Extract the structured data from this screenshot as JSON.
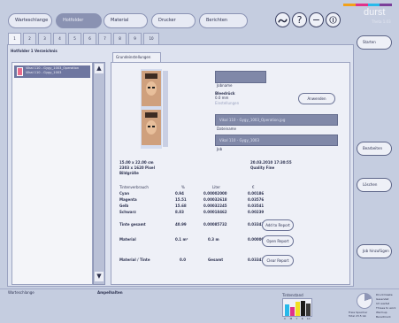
{
  "top_nav": {
    "tabs": [
      {
        "label": "Warteschlange"
      },
      {
        "label": "Hotfolder"
      },
      {
        "label": "Material"
      },
      {
        "label": "Drucker"
      },
      {
        "label": "Berichten"
      }
    ]
  },
  "brand": {
    "name": "durst",
    "sub": "Theta 1.03"
  },
  "hotfolder_tabs": [
    "1",
    "2",
    "3",
    "4",
    "5",
    "6",
    "7",
    "8",
    "9",
    "10"
  ],
  "left_panel": {
    "title": "Hotfolder 1 Verzeichnis",
    "files": [
      "Vikal 110 - Gygy_1003_Operation",
      "Vikal 110 - Gygy_1003"
    ]
  },
  "detail_tab": "Grundeinstellungen",
  "detail": {
    "field1_label": "Jobname",
    "layout_label": "Bleedrück",
    "layout_value": "0.0 mm",
    "layout_sub": "Einstellungen",
    "position_label": "Ausrichten",
    "file1": "Vikal 110 - Gygy_1003_Operation.jpg",
    "file1_label": "Dateiname",
    "file2": "Vikal 110 - Gygy_1003",
    "file2_label": "Job",
    "size": "15.00 x 22.00 cm",
    "resolution": "2303 x 1620 Pixel",
    "mode": "Bildgröße",
    "datetime": "20.03.2010 17:30:55",
    "quality": "Quality Fine"
  },
  "ink_table": {
    "headers": [
      "Tintenverbrauch",
      "%",
      "Liter",
      "€"
    ],
    "rows": [
      {
        "name": "Cyan",
        "pct": "0.94",
        "liter": "0.00002000",
        "eur": "0.00186"
      },
      {
        "name": "Magenta",
        "pct": "15.51",
        "liter": "0.00032618",
        "eur": "0.03576"
      },
      {
        "name": "Gelb",
        "pct": "15.68",
        "liter": "0.00032245",
        "eur": "0.03541"
      },
      {
        "name": "Schwarz",
        "pct": "8.83",
        "liter": "0.00018462",
        "eur": "0.00239"
      }
    ],
    "total": {
      "name": "Tinte gesamt",
      "pct": "40.99",
      "liter": "0.00085732",
      "eur": "0.03343"
    },
    "material": {
      "name": "Material",
      "a": "0.1 m²",
      "b": "0.3 m",
      "eur": "0.00000"
    },
    "material_ink": {
      "name": "Material / Tinte",
      "a": "0.0",
      "b": "Gesamt",
      "eur": "0.03343"
    }
  },
  "buttons": {
    "add_to_report": "Add to Report",
    "open_report": "Open Report",
    "clear_report": "Clear Report",
    "anwenden": "Anwenden",
    "starten": "Starten",
    "bearbeiten": "Bearbeiten",
    "loeschen": "Löschen",
    "job_hinzufuegen": "Job hinzufügen"
  },
  "status_bar": {
    "left": "Warteschlange",
    "center": "Ampelhalten"
  },
  "ink_levels": {
    "title": "Tintenstand",
    "bars": [
      {
        "name": "C",
        "color": "#28b9ea",
        "level": 0.7
      },
      {
        "name": "M",
        "color": "#e0338b",
        "level": 0.55
      },
      {
        "name": "Y",
        "color": "#f1e021",
        "level": 0.85
      },
      {
        "name": "K",
        "color": "#1a1a1a",
        "level": 0.9
      },
      {
        "name": "LC",
        "color": "#3a3a3a",
        "level": 0.75
      }
    ]
  },
  "printer_status": {
    "label": "Freie Speicher",
    "value": "Total 23.5 Gb",
    "legend": [
      "Druckmaske",
      "Gesendet",
      "Ich wartet",
      "Threes to work",
      "Warmup",
      "Bereitmodi"
    ]
  }
}
